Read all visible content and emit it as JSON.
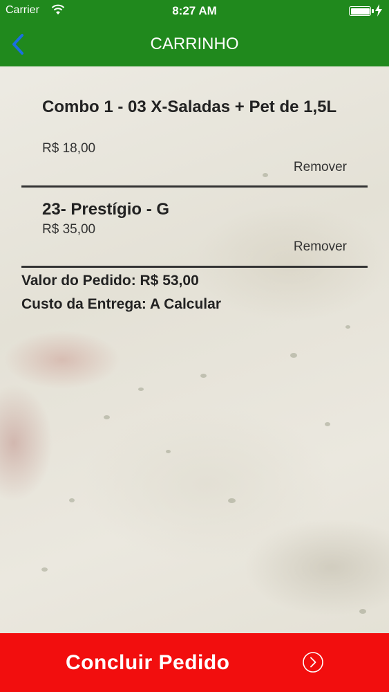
{
  "status_bar": {
    "carrier": "Carrier",
    "time": "8:27 AM",
    "icons": [
      "wifi-icon",
      "battery-icon",
      "charge-icon"
    ],
    "battery_level": 1.0
  },
  "nav": {
    "title": "CARRINHO",
    "back_icon": "chevron-left-icon"
  },
  "cart": {
    "items": [
      {
        "name": "Combo 1 - 03 X-Saladas + Pet de 1,5L",
        "price": "R$ 18,00",
        "remove_label": "Remover"
      },
      {
        "name": "23- Prestígio - G",
        "price": "R$ 35,00",
        "remove_label": "Remover"
      }
    ],
    "order_value": "Valor do Pedido: R$ 53,00",
    "delivery_cost": "Custo da Entrega: A Calcular"
  },
  "footer": {
    "button_label": "Concluir Pedido",
    "button_icon": "chevron-right-circle-icon"
  },
  "colors": {
    "header_green": "#20891d",
    "button_red": "#f20e0e",
    "back_arrow_blue": "#1a6fe0"
  }
}
